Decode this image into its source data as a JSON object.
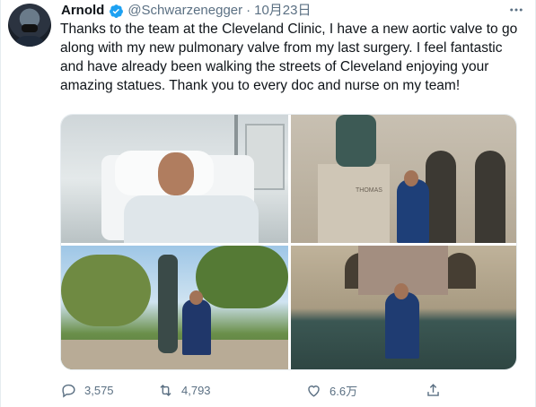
{
  "tweet": {
    "author_name": "Arnold",
    "handle": "@Schwarzenegger",
    "separator": "·",
    "date": "10月23日",
    "text": "Thanks to the team at the Cleveland Clinic, I have a new aortic valve to go along with my new pulmonary valve from my last surgery. I feel fantastic and have already been walking the streets of Cleveland enjoying your amazing statues. Thank you to every doc and nurse on my team!",
    "verified": true
  },
  "media": {
    "photos": [
      {
        "icon": "hospital-bed-photo"
      },
      {
        "icon": "statue-building-photo"
      },
      {
        "icon": "park-statue-photo"
      },
      {
        "icon": "monument-wall-photo"
      }
    ],
    "plaque_text": "THOMAS"
  },
  "actions": {
    "reply_count": "3,575",
    "retweet_count": "4,793",
    "like_count": "6.6万"
  },
  "colors": {
    "accent": "#1da1f2",
    "muted": "#5b7083",
    "text": "#0f1419"
  }
}
